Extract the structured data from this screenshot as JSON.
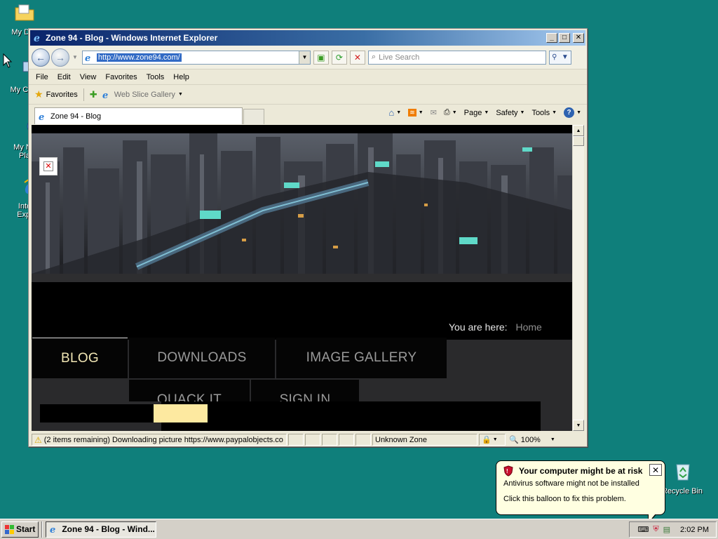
{
  "desktop": {
    "icons": [
      {
        "label": "My Doc"
      },
      {
        "label": "My Com"
      },
      {
        "label": "My Ne\nPla"
      },
      {
        "label": "Inte\nExpl"
      },
      {
        "label": "Recycle Bin"
      }
    ]
  },
  "window": {
    "title": "Zone 94 - Blog - Windows Internet Explorer",
    "address": "http://www.zone94.com/",
    "search_placeholder": "Live Search",
    "menu": [
      "File",
      "Edit",
      "View",
      "Favorites",
      "Tools",
      "Help"
    ],
    "favorites_label": "Favorites",
    "web_slice_label": "Web Slice Gallery",
    "tab_title": "Zone 94 - Blog",
    "commands": {
      "page": "Page",
      "safety": "Safety",
      "tools": "Tools"
    },
    "status": {
      "text": "(2 items remaining) Downloading picture https://www.paypalobjects.co",
      "zone": "Unknown Zone",
      "zoom": "100%"
    }
  },
  "site": {
    "nav": {
      "blog": "BLOG",
      "downloads": "DOWNLOADS",
      "gallery": "IMAGE GALLERY",
      "quack": "QUACK IT",
      "signin": "SIGN IN"
    },
    "breadcrumb_label": "You are here:",
    "breadcrumb_home": "Home",
    "colors": {
      "active": "#f1e6b4",
      "inactive": "#9a9a9a",
      "highlight": "#fde9a0"
    }
  },
  "balloon": {
    "title": "Your computer might be at risk",
    "line1": "Antivirus software might not be installed",
    "line2": "Click this balloon to fix this problem."
  },
  "taskbar": {
    "start": "Start",
    "task": "Zone 94 - Blog - Wind...",
    "clock": "2:02 PM"
  }
}
